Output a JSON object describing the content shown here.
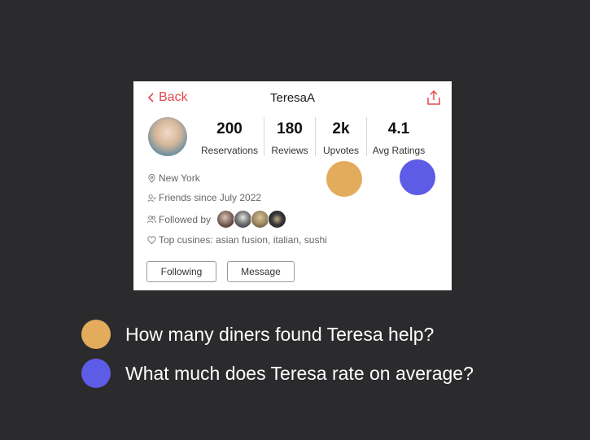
{
  "header": {
    "back_label": "Back",
    "title": "TeresaA"
  },
  "stats": [
    {
      "value": "200",
      "label": "Reservations"
    },
    {
      "value": "180",
      "label": "Reviews"
    },
    {
      "value": "2k",
      "label": "Upvotes"
    },
    {
      "value": "4.1",
      "label": "Avg Ratings"
    }
  ],
  "info": {
    "location": "New York",
    "friends_since": "Friends since July 2022",
    "followed_by": "Followed by",
    "top_cuisines": "Top cusines: asian fusion, italian, sushi"
  },
  "buttons": {
    "following": "Following",
    "message": "Message"
  },
  "annotations": [
    {
      "text": "How many diners found Teresa help?",
      "color": "#e2ac5c"
    },
    {
      "text": "What much does Teresa rate on average?",
      "color": "#5d5ce6"
    }
  ],
  "colors": {
    "accent": "#e5484d",
    "background": "#2b2b2d"
  }
}
